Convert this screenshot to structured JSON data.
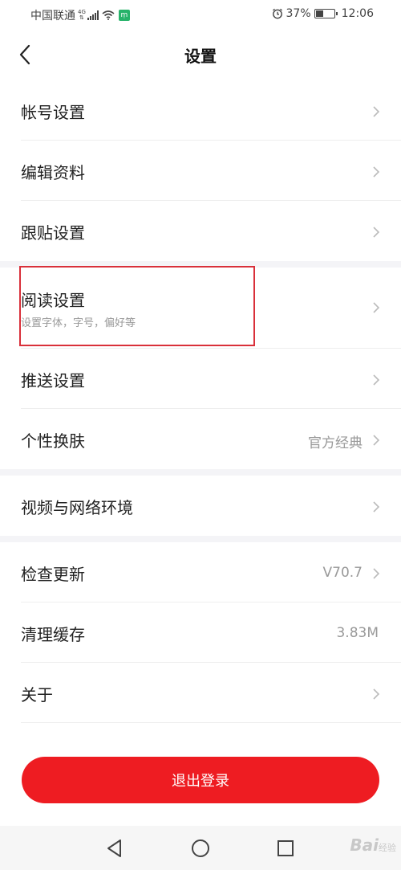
{
  "status_bar": {
    "carrier": "中国联通",
    "network_top": "4G",
    "network_bottom": "⇅",
    "app_badge": "ṃ",
    "battery": "37%",
    "time": "12:06"
  },
  "header": {
    "title": "设置"
  },
  "groups": [
    {
      "items": [
        {
          "label": "帐号设置"
        },
        {
          "label": "编辑资料"
        },
        {
          "label": "跟贴设置"
        }
      ]
    },
    {
      "items": [
        {
          "label": "阅读设置",
          "sub": "设置字体，字号，偏好等"
        },
        {
          "label": "推送设置"
        },
        {
          "label": "个性换肤",
          "value": "官方经典"
        }
      ]
    },
    {
      "items": [
        {
          "label": "视频与网络环境"
        }
      ]
    },
    {
      "items": [
        {
          "label": "检查更新",
          "value": "V70.7"
        },
        {
          "label": "清理缓存",
          "value": "3.83M"
        },
        {
          "label": "关于"
        }
      ]
    }
  ],
  "logout": {
    "label": "退出登录"
  },
  "watermark": {
    "text": "Bai",
    "sub": "经验"
  },
  "colors": {
    "accent": "#ee1c22",
    "highlight": "#d9303a",
    "separator": "#f4f4f7"
  }
}
